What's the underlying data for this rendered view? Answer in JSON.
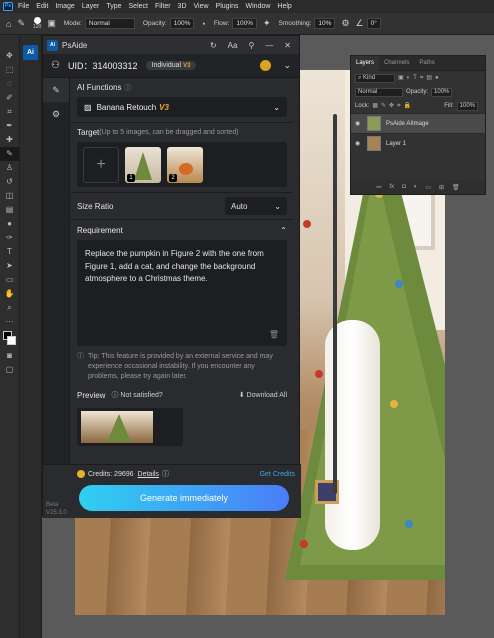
{
  "menubar": {
    "logo": "Ps",
    "items": [
      "File",
      "Edit",
      "Image",
      "Layer",
      "Type",
      "Select",
      "Filter",
      "3D",
      "View",
      "Plugins",
      "Window",
      "Help"
    ]
  },
  "optionsbar": {
    "brush_size": "120",
    "mode_label": "Mode:",
    "mode_value": "Normal",
    "opacity_label": "Opacity:",
    "opacity_value": "100%",
    "flow_label": "Flow:",
    "flow_value": "100%",
    "smoothing_label": "Smoothing:",
    "smoothing_value": "10%",
    "angle_value": "0°"
  },
  "app": {
    "title": "PsAide",
    "col_icon": "Ai"
  },
  "account": {
    "uid_label": "UID：314003312",
    "plan": "Individual",
    "plan_badge": "V3"
  },
  "ai_functions": {
    "label": "AI Functions",
    "selected": "Banana Retouch",
    "selected_badge": "V3"
  },
  "target": {
    "label": "Target",
    "hint": "(Up to 5 images, can be dragged and sorted)",
    "images": [
      {
        "num": "1"
      },
      {
        "num": "2"
      }
    ]
  },
  "size_ratio": {
    "label": "Size Ratio",
    "value": "Auto"
  },
  "requirement": {
    "label": "Requirement",
    "text": "Replace the pumpkin in Figure 2 with the one from Figure 1, add a cat, and change the background atmosphere to a Christmas theme."
  },
  "tip": "Tip: This feature is provided by an external service and may experience occasional instability. If you encounter any problems, please try again later.",
  "preview": {
    "label": "Preview",
    "not_satisfied": "Not satisfied?",
    "download_all": "Download All"
  },
  "footer": {
    "credits": "Credits: 29696",
    "details": "Details",
    "get_credits": "Get Credits",
    "generate": "Generate immediately",
    "beta": "Beta",
    "version": "V25.3.0"
  },
  "layers_panel": {
    "tabs": [
      "Layers",
      "Channels",
      "Paths"
    ],
    "kind": "Kind",
    "blend": "Normal",
    "opacity_label": "Opacity:",
    "opacity_value": "100%",
    "lock_label": "Lock:",
    "fill_label": "Fill:",
    "fill_value": "100%",
    "layers": [
      {
        "name": "PsAide AIImage"
      },
      {
        "name": "Layer 1"
      }
    ]
  },
  "colors": {
    "accent": "#31a8ff",
    "gold": "#e8a23a",
    "generate_start": "#2fd0f0",
    "generate_end": "#4a7df8"
  },
  "icons": [
    "user-icon",
    "refresh-icon",
    "font-size-icon",
    "pin-icon",
    "minimize-icon",
    "close-icon",
    "edit-icon",
    "gear-icon",
    "info-icon",
    "image-icon",
    "trash-icon",
    "download-icon",
    "coin-icon"
  ]
}
